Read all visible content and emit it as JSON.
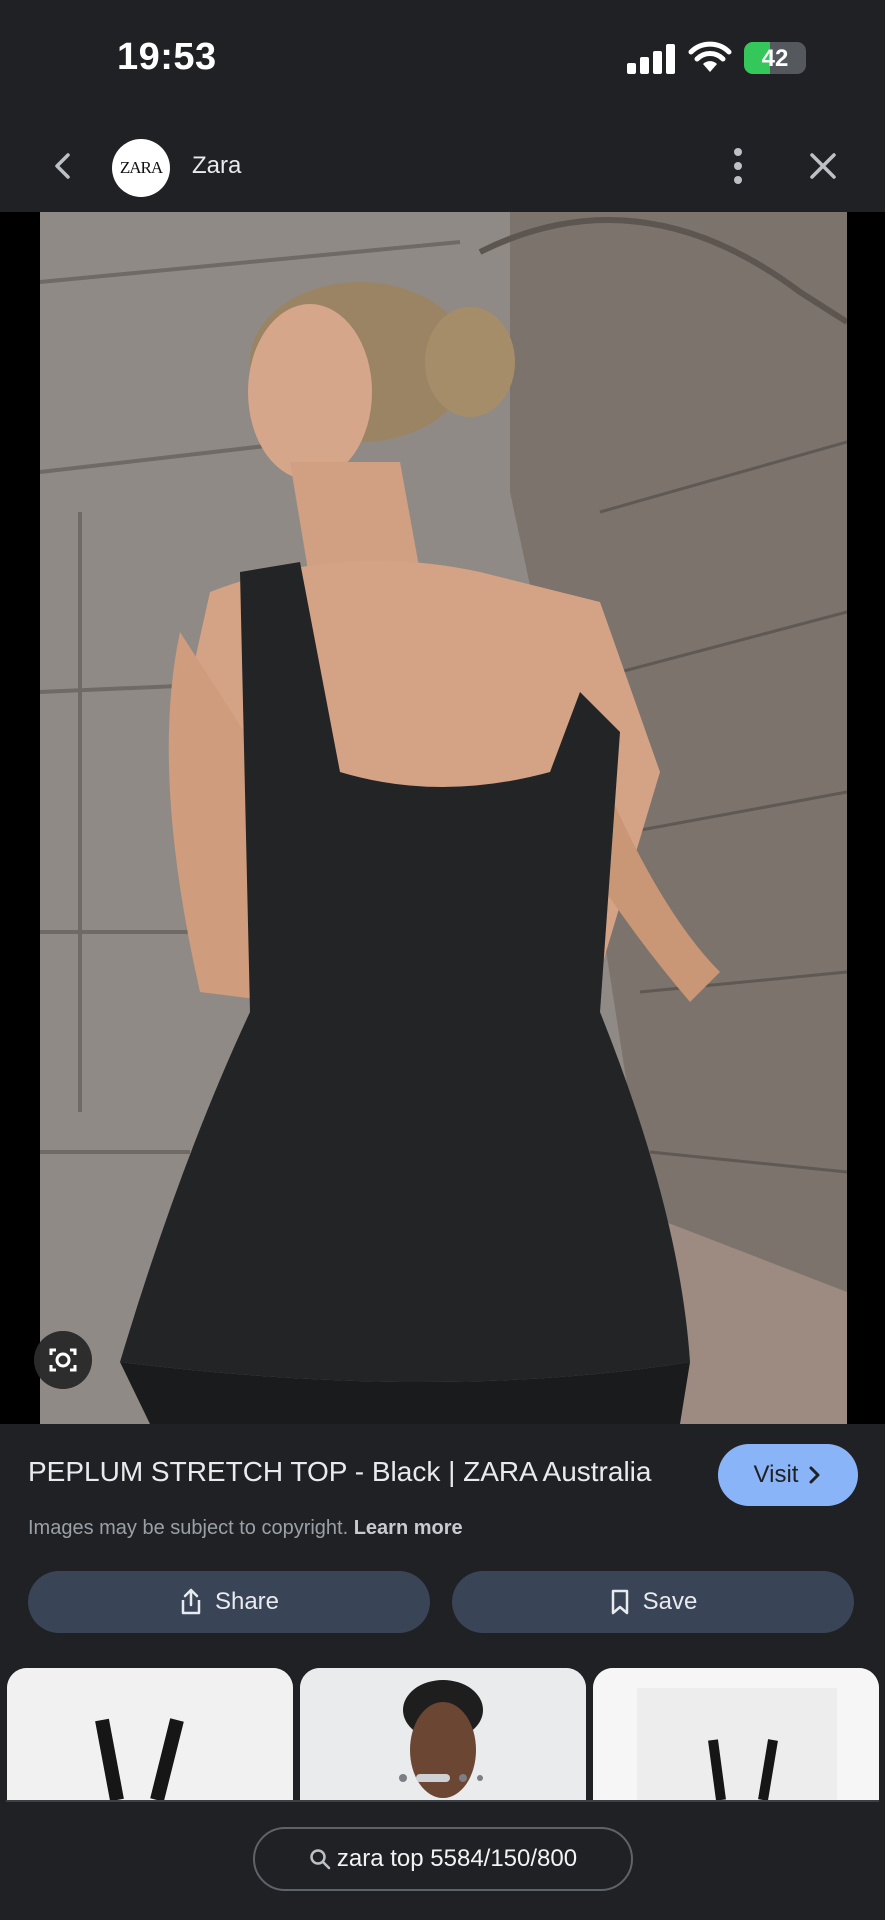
{
  "status_bar": {
    "time": "19:53",
    "battery": "42"
  },
  "header": {
    "site_logo": "ZARA",
    "site_name": "Zara"
  },
  "result": {
    "title": "PEPLUM STRETCH TOP - Black | ZARA Australia",
    "visit_label": "Visit",
    "copyright_text": "Images may be subject to copyright.",
    "learn_more": "Learn more",
    "share_label": "Share",
    "save_label": "Save"
  },
  "search": {
    "query": "zara top 5584/150/800"
  },
  "carousel": {
    "dots": 4,
    "active_dot": 1
  },
  "colors": {
    "background": "#202124",
    "accent": "#8ab4f8",
    "button": "#394457"
  },
  "icons": [
    "back-icon",
    "more-vert-icon",
    "close-icon",
    "lens-icon",
    "chevron-right-icon",
    "share-icon",
    "bookmark-icon",
    "search-icon"
  ]
}
